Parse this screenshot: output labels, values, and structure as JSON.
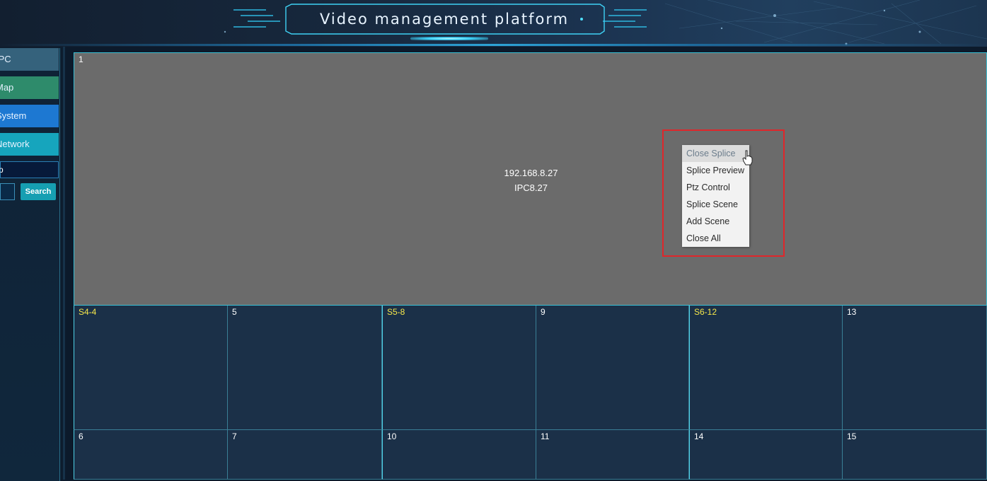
{
  "header": {
    "title": "Video management platform"
  },
  "sidebar": {
    "items": [
      {
        "label": "IPC",
        "color": "#35627c"
      },
      {
        "label": "Map",
        "color": "#2e8b6b"
      },
      {
        "label": "System",
        "color": "#1d78d2"
      },
      {
        "label": "Network",
        "color": "#16a5bd"
      }
    ],
    "search_value": "p",
    "search_button": "Search"
  },
  "grid": {
    "main_cell": {
      "label": "1",
      "ip": "192.168.8.27",
      "name": "IPC8.27"
    },
    "row2": [
      "S4-4",
      "5",
      "S5-8",
      "9",
      "S6-12",
      "13"
    ],
    "row3": [
      "6",
      "7",
      "10",
      "11",
      "14",
      "15"
    ]
  },
  "context_menu": {
    "items": [
      "Close Splice",
      "Splice Preview",
      "Ptz Control",
      "Splice Scene",
      "Add Scene",
      "Close All"
    ]
  },
  "colors": {
    "accent": "#3ac1d6",
    "highlight": "#e0262a",
    "splice_label": "#f5e64a"
  }
}
